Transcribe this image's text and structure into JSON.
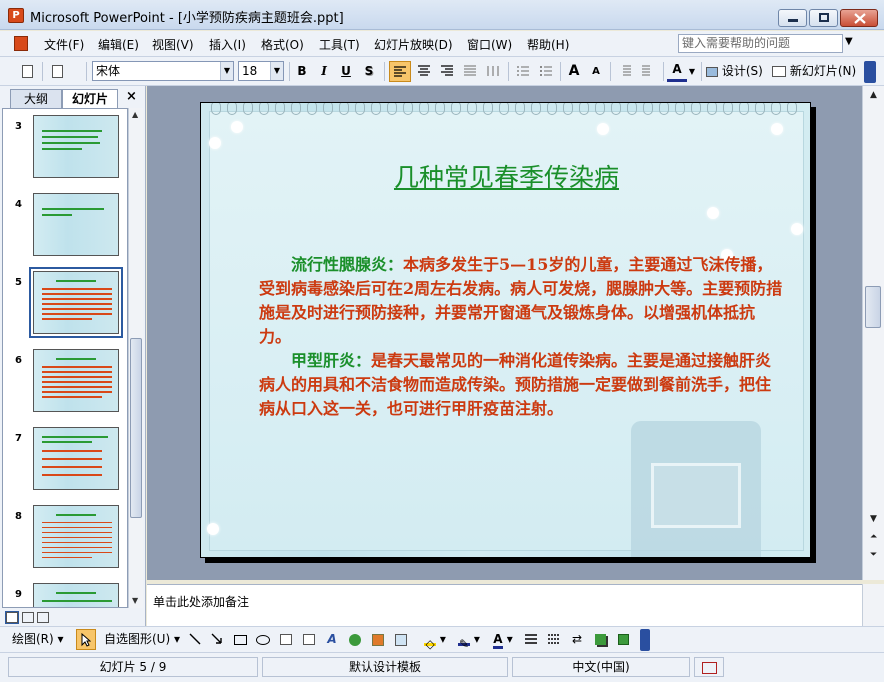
{
  "window": {
    "title": "Microsoft PowerPoint - [小学预防疾病主题班会.ppt]",
    "app_icon_letter": "P"
  },
  "menu": {
    "items": [
      "文件(F)",
      "编辑(E)",
      "视图(V)",
      "插入(I)",
      "格式(O)",
      "工具(T)",
      "幻灯片放映(D)",
      "窗口(W)",
      "帮助(H)"
    ],
    "help_placeholder": "键入需要帮助的问题"
  },
  "toolbar": {
    "font_name": "宋体",
    "font_size": "18",
    "bold": "B",
    "italic": "I",
    "underline": "U",
    "shadow": "S",
    "increase_font": "A",
    "decrease_font": "A",
    "font_color": "A",
    "design_label": "设计(S)",
    "new_slide_label": "新幻灯片(N)"
  },
  "panel": {
    "tabs": [
      "大纲",
      "幻灯片"
    ],
    "active_tab": "幻灯片",
    "close_glyph": "×",
    "thumbnails": [
      {
        "num": "3",
        "selected": false
      },
      {
        "num": "4",
        "selected": false
      },
      {
        "num": "5",
        "selected": true
      },
      {
        "num": "6",
        "selected": false
      },
      {
        "num": "7",
        "selected": false
      },
      {
        "num": "8",
        "selected": false
      },
      {
        "num": "9",
        "selected": false
      }
    ]
  },
  "slide": {
    "title": "几种常见春季传染病",
    "para1_lead": "流行性腮腺炎：",
    "para1_rest": "本病多发生于5—15岁的儿童，主要通过飞沫传播，受到病毒感染后可在2周左右发病。病人可发烧，腮腺肿大等。主要预防措施是及时进行预防接种，并要常开窗通气及锻炼身体。以增强机体抵抗力。",
    "para2_lead": "甲型肝炎：",
    "para2_rest": "是春天最常见的一种消化道传染病。主要是通过接触肝炎病人的用具和不洁食物而造成传染。预防措施一定要做到餐前洗手，把住病从口入这一关，也可进行甲肝疫苗注射。",
    "title_color": "#1a8f2a",
    "body_color": "#cc3a10"
  },
  "notes": {
    "placeholder": "单击此处添加备注"
  },
  "drawbar": {
    "draw_label": "绘图(R)",
    "autoshapes_label": "自选图形(U)"
  },
  "status": {
    "slide_counter": "幻灯片 5 / 9",
    "template": "默认设计模板",
    "language": "中文(中国)"
  }
}
